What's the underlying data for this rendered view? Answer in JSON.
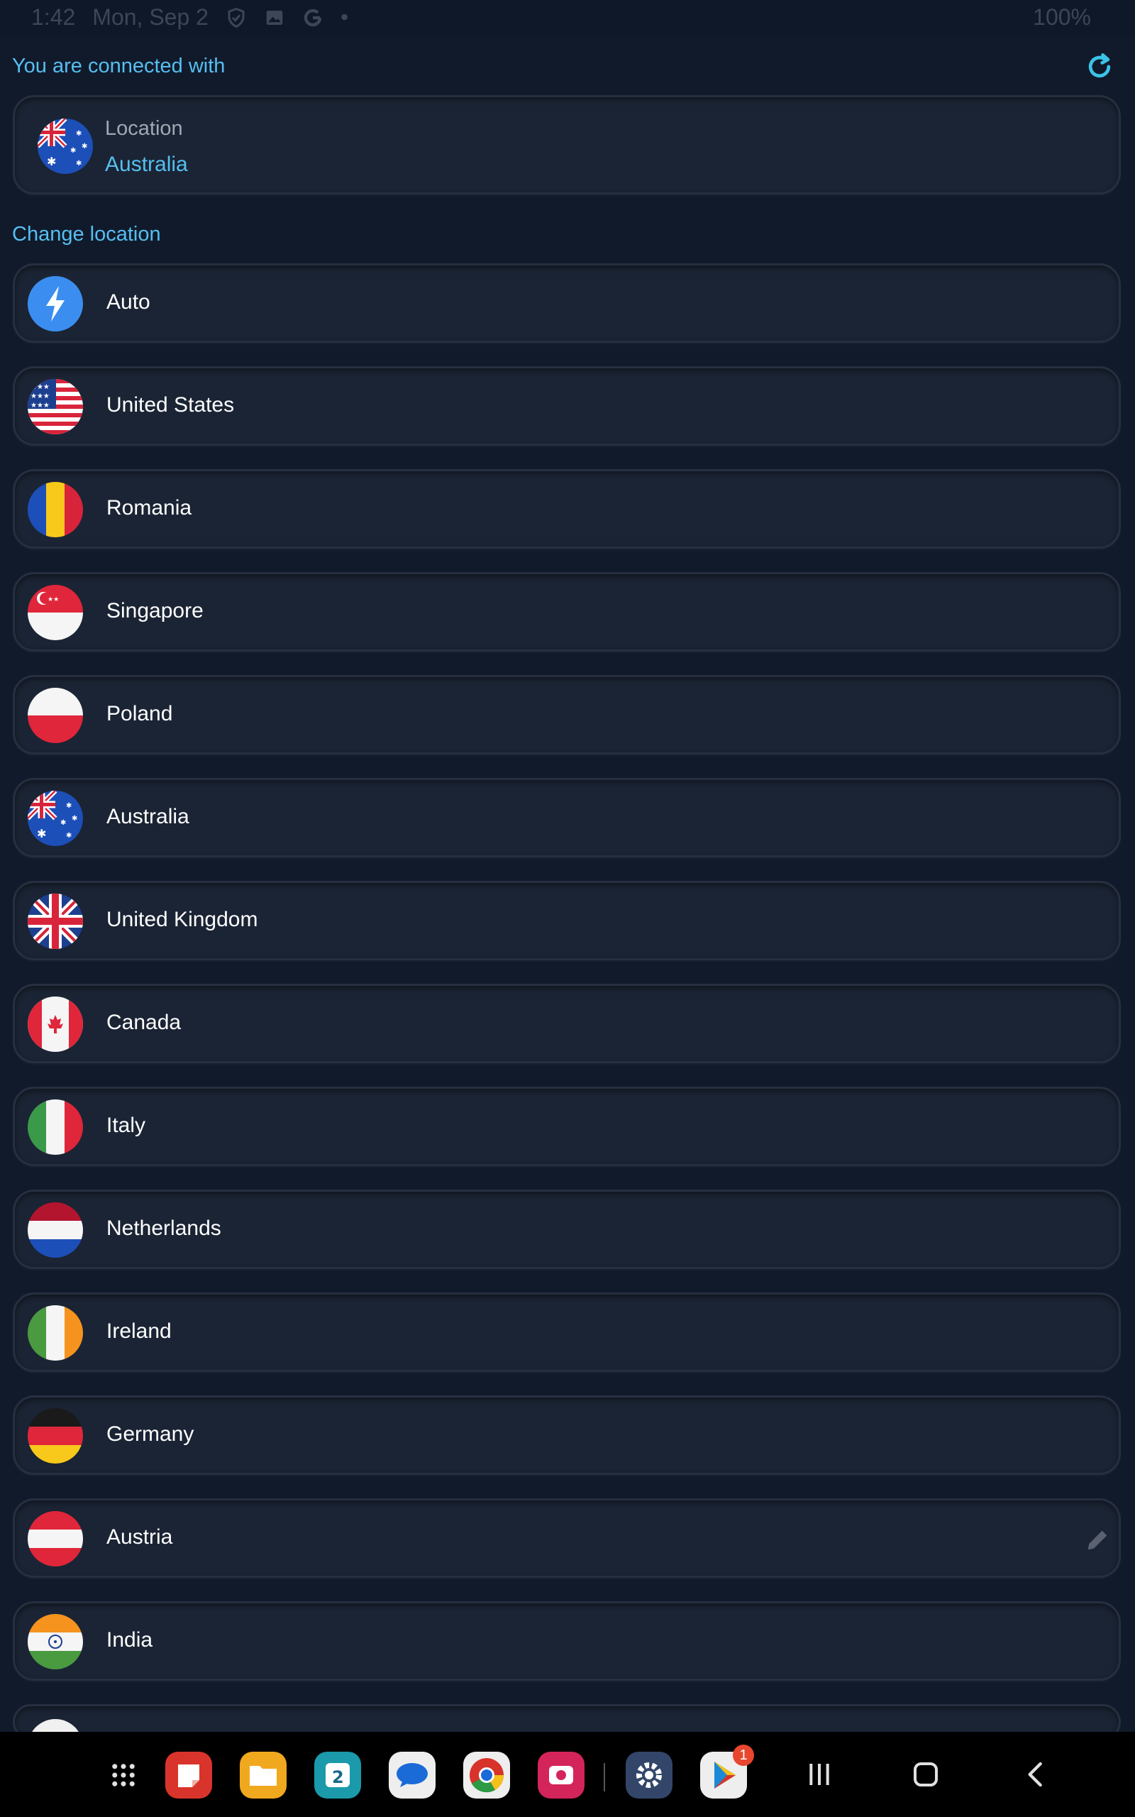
{
  "status_bar": {
    "time": "1:42",
    "date": "Mon, Sep 2",
    "battery": "100%"
  },
  "connected": {
    "heading": "You are connected with",
    "label": "Location",
    "value": "Australia",
    "flag": "australia-flag"
  },
  "change_location": {
    "heading": "Change location",
    "items": [
      {
        "label": "Auto",
        "icon": "lightning-icon"
      },
      {
        "label": "United States",
        "icon": "united-states-flag"
      },
      {
        "label": "Romania",
        "icon": "romania-flag"
      },
      {
        "label": "Singapore",
        "icon": "singapore-flag"
      },
      {
        "label": "Poland",
        "icon": "poland-flag"
      },
      {
        "label": "Australia",
        "icon": "australia-flag"
      },
      {
        "label": "United Kingdom",
        "icon": "united-kingdom-flag"
      },
      {
        "label": "Canada",
        "icon": "canada-flag"
      },
      {
        "label": "Italy",
        "icon": "italy-flag"
      },
      {
        "label": "Netherlands",
        "icon": "netherlands-flag"
      },
      {
        "label": "Ireland",
        "icon": "ireland-flag"
      },
      {
        "label": "Germany",
        "icon": "germany-flag"
      },
      {
        "label": "Austria",
        "icon": "austria-flag"
      },
      {
        "label": "India",
        "icon": "india-flag"
      }
    ]
  },
  "dock": {
    "apps": [
      "app-drawer-icon",
      "notes-app-icon",
      "files-app-icon",
      "calendar-app-icon",
      "messages-app-icon",
      "chrome-app-icon",
      "camera-app-icon",
      "settings-app-icon",
      "play-store-app-icon"
    ],
    "play_store_badge": "1"
  },
  "colors": {
    "background": "#111a2b",
    "card": "#1b2434",
    "accent": "#55bff0"
  }
}
